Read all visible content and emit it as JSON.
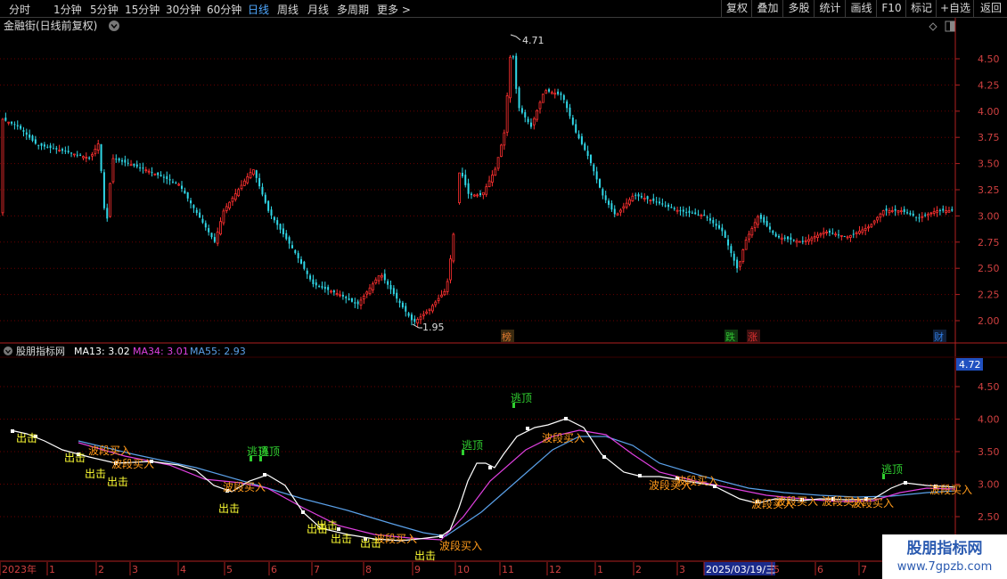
{
  "toolbar": {
    "periods": [
      "分时",
      "1分钟",
      "5分钟",
      "15分钟",
      "30分钟",
      "60分钟",
      "日线",
      "周线",
      "月线",
      "多周期"
    ],
    "active_period": "日线",
    "more_label": "更多",
    "right_buttons": [
      "复权",
      "叠加",
      "多股",
      "统计",
      "画线",
      "F10",
      "标记",
      "+自选",
      "返回"
    ]
  },
  "price_panel": {
    "title": "金融街(日线前复权)",
    "high_label": "4.71",
    "low_label": "1.95",
    "y_ticks": [
      "4.50",
      "4.25",
      "4.00",
      "3.75",
      "3.50",
      "3.25",
      "3.00",
      "2.75",
      "2.50",
      "2.25",
      "2.00"
    ],
    "event_markers": [
      {
        "text": "榜",
        "color": "#e07a30"
      },
      {
        "text": "跌",
        "color": "#30c030"
      },
      {
        "text": "涨",
        "color": "#e03030"
      },
      {
        "text": "财",
        "color": "#2f7be0"
      }
    ]
  },
  "indicator_panel": {
    "name": "股朋指标网",
    "ma13_label": "MA13: 3.02",
    "ma34_label": "MA34: 3.01",
    "ma55_label": "MA55: 2.93",
    "current_value": "4.72",
    "y_ticks": [
      "4.50",
      "4.00",
      "3.50",
      "3.00",
      "2.50"
    ],
    "signals": {
      "escape_top": "逃顶",
      "buy": "波段买入",
      "attack": "出击"
    },
    "colors": {
      "ma13": "#ffffff",
      "ma34": "#e040e0",
      "ma55": "#5aa0e8",
      "escape": "#30d030",
      "buy": "#ff9a1a",
      "attack": "#ffff33"
    }
  },
  "timeline": {
    "labels": [
      "2023年",
      "1",
      "2",
      "3",
      "4",
      "5",
      "6",
      "7",
      "8",
      "9",
      "10",
      "11",
      "12",
      "1",
      "2",
      "3",
      "2025/03/19/三",
      "5",
      "6",
      "7"
    ]
  },
  "watermark": {
    "title": "股朋指标网",
    "url": "www.7gpzb.com"
  }
}
